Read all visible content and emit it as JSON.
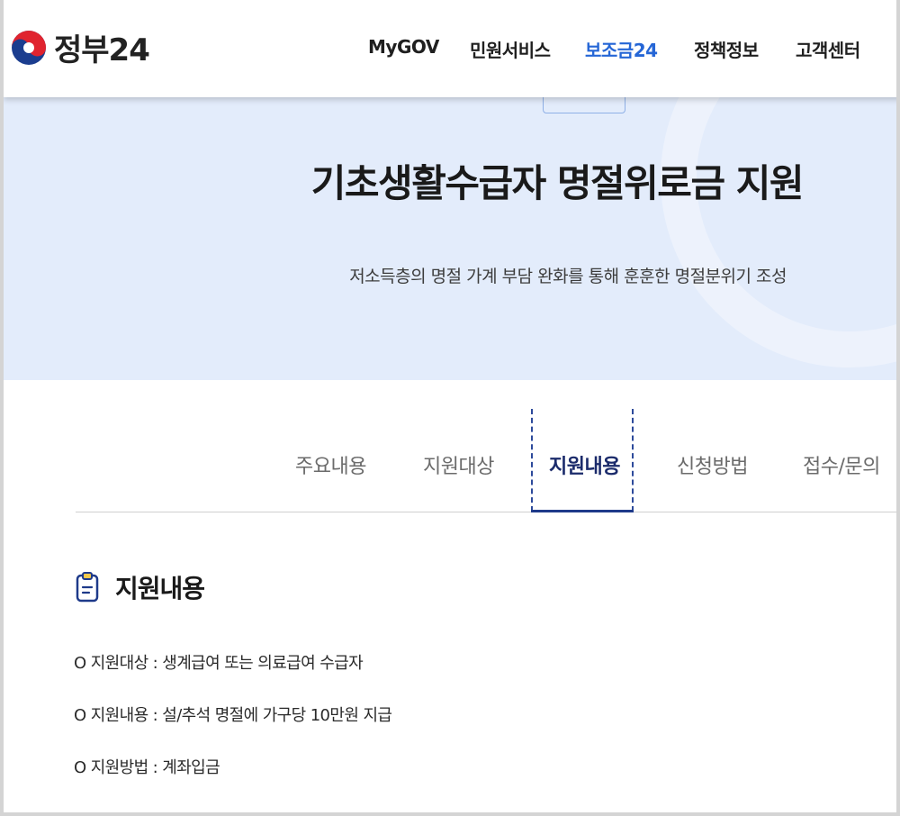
{
  "header": {
    "logo_text": "정부24",
    "nav": [
      {
        "label": "MyGOV"
      },
      {
        "label": "민원서비스"
      },
      {
        "label": "보조금24",
        "active": true
      },
      {
        "label": "정책정보"
      },
      {
        "label": "고객센터"
      }
    ],
    "accent_color": "#2566d6"
  },
  "hero": {
    "title": "기초생활수급자 명절위로금 지원",
    "subtitle": "저소득층의 명절 가계 부담 완화를 통해 훈훈한 명절분위기 조성",
    "background_color": "#e3ecfb"
  },
  "tabs": [
    {
      "label": "주요내용"
    },
    {
      "label": "지원대상"
    },
    {
      "label": "지원내용",
      "active": true
    },
    {
      "label": "신청방법"
    },
    {
      "label": "접수/문의"
    }
  ],
  "section": {
    "icon": "clipboard-icon",
    "title": "지원내용",
    "items": [
      "O 지원대상 : 생계급여 또는 의료급여 수급자",
      "O 지원내용 : 설/추석 명절에 가구당 10만원 지급",
      "O 지원방법 : 계좌입금"
    ]
  }
}
